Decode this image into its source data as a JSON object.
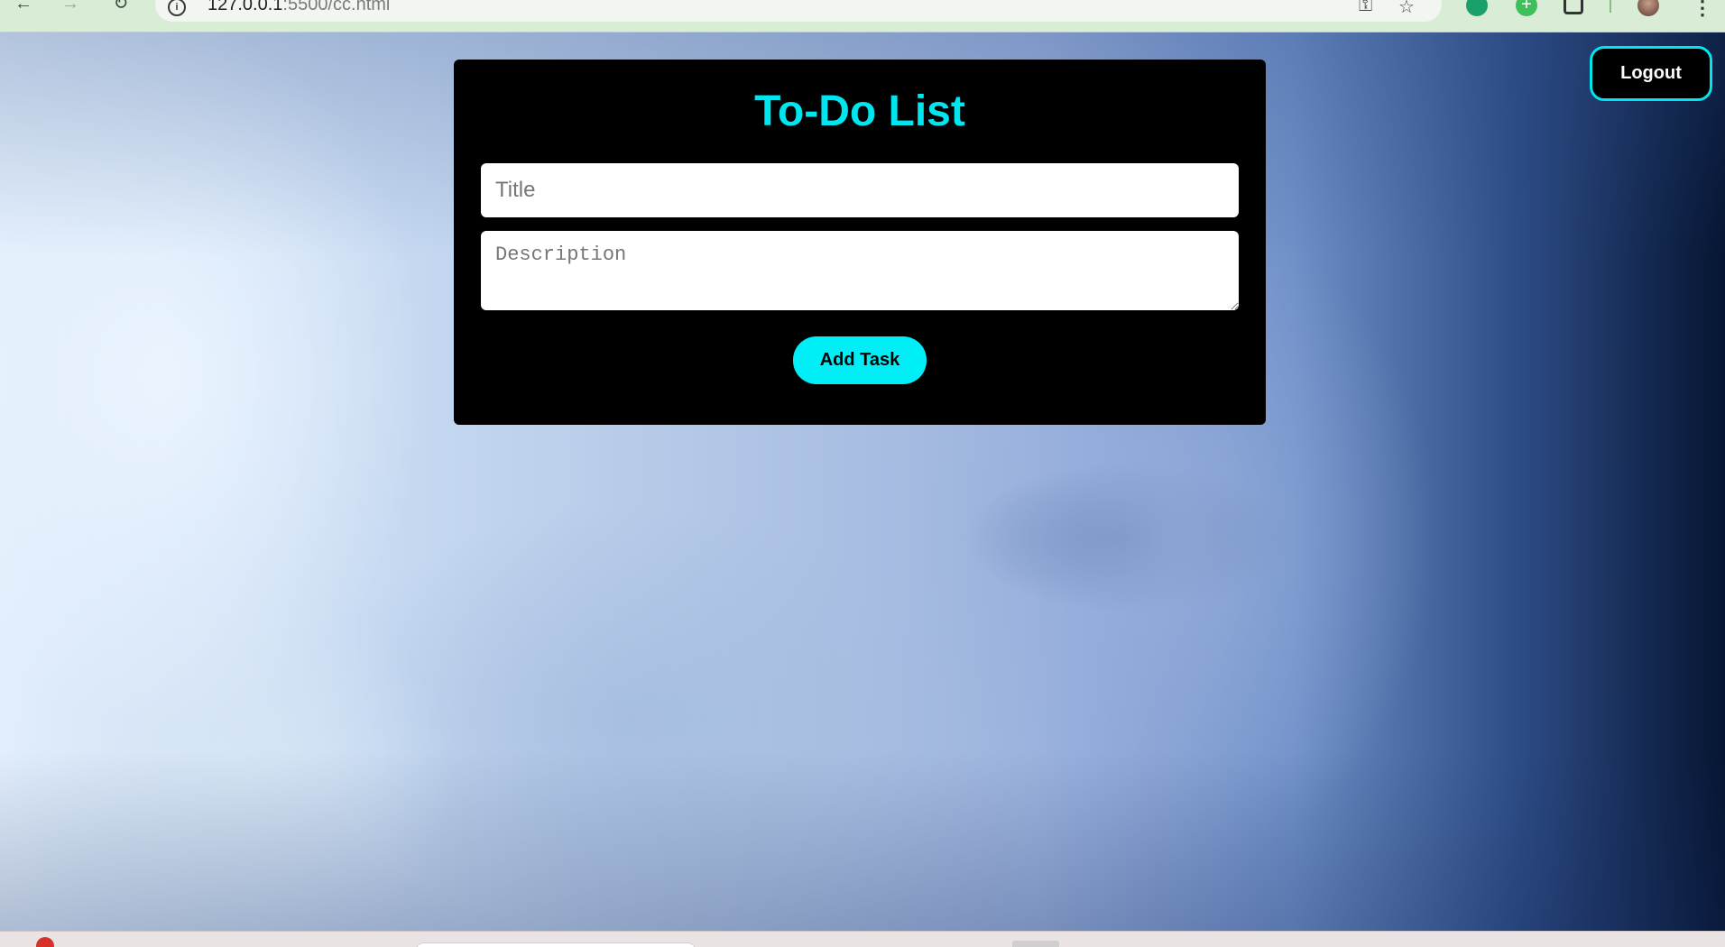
{
  "browser": {
    "url_host": "127.0.0.1",
    "url_rest": ":5500/cc.html",
    "back_glyph": "←",
    "forward_glyph": "→",
    "reload_glyph": "↻",
    "info_glyph": "i",
    "password_glyph": "⚿",
    "bookmark_glyph": "☆",
    "plus_glyph": "+",
    "menu_glyph": "⋮",
    "icons": [
      "back-arrow-icon",
      "forward-arrow-icon",
      "reload-icon",
      "site-info-icon",
      "password-key-icon",
      "bookmark-star-icon",
      "whatsapp-icon",
      "plus-icon",
      "extensions-puzzle-icon",
      "profile-avatar",
      "menu-dots-icon"
    ]
  },
  "header": {
    "logout_label": "Logout"
  },
  "todo": {
    "title": "To-Do List",
    "title_placeholder": "Title",
    "description_placeholder": "Description",
    "add_button_label": "Add Task"
  },
  "colors": {
    "accent": "#00e5ee",
    "card_background": "#000000",
    "button_background": "#00eef5"
  }
}
